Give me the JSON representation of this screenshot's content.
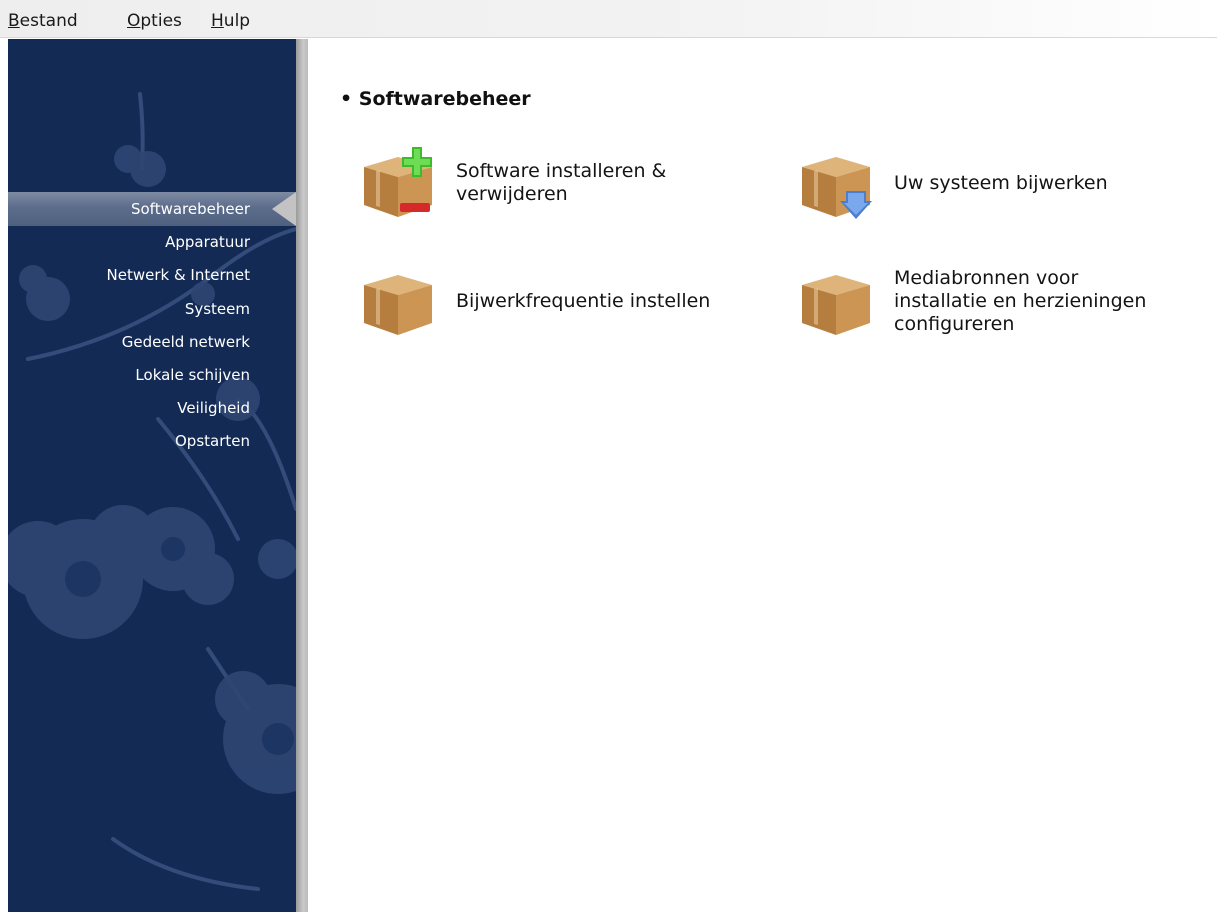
{
  "menubar": {
    "items": [
      {
        "label": "Bestand",
        "mnemonic": "B",
        "rest": "estand"
      },
      {
        "label": "Opties",
        "mnemonic": "O",
        "rest": "pties"
      },
      {
        "label": "Hulp",
        "mnemonic": "H",
        "rest": "ulp"
      }
    ]
  },
  "sidebar": {
    "selected": "Softwarebeheer",
    "items": [
      {
        "label": "Softwarebeheer"
      },
      {
        "label": "Apparatuur"
      },
      {
        "label": "Netwerk & Internet"
      },
      {
        "label": "Systeem"
      },
      {
        "label": "Gedeeld netwerk"
      },
      {
        "label": "Lokale schijven"
      },
      {
        "label": "Veiligheid"
      },
      {
        "label": "Opstarten"
      }
    ]
  },
  "main": {
    "section_title": "Softwarebeheer",
    "bullet": "•",
    "tools": [
      {
        "label_line1": "Software installeren &",
        "label_line2": "verwijderen",
        "icon": "package-add-remove-icon"
      },
      {
        "label_line1": "Uw systeem bijwerken",
        "label_line2": "",
        "icon": "package-update-icon"
      },
      {
        "label_line1": "Bijwerkfrequentie instellen",
        "label_line2": "",
        "icon": "package-icon"
      },
      {
        "label_line1": "Mediabronnen voor",
        "label_line2": "installatie en herzieningen",
        "label_line3": "configureren",
        "icon": "package-media-icon"
      }
    ]
  },
  "colors": {
    "sidebar_bg": "#132a55",
    "sidebar_selected": "#5d6d8c",
    "box_brown": "#c08a4a",
    "plus_green": "#3dbb2c",
    "minus_red": "#d62a2a",
    "arrow_blue": "#4a7fd0"
  }
}
